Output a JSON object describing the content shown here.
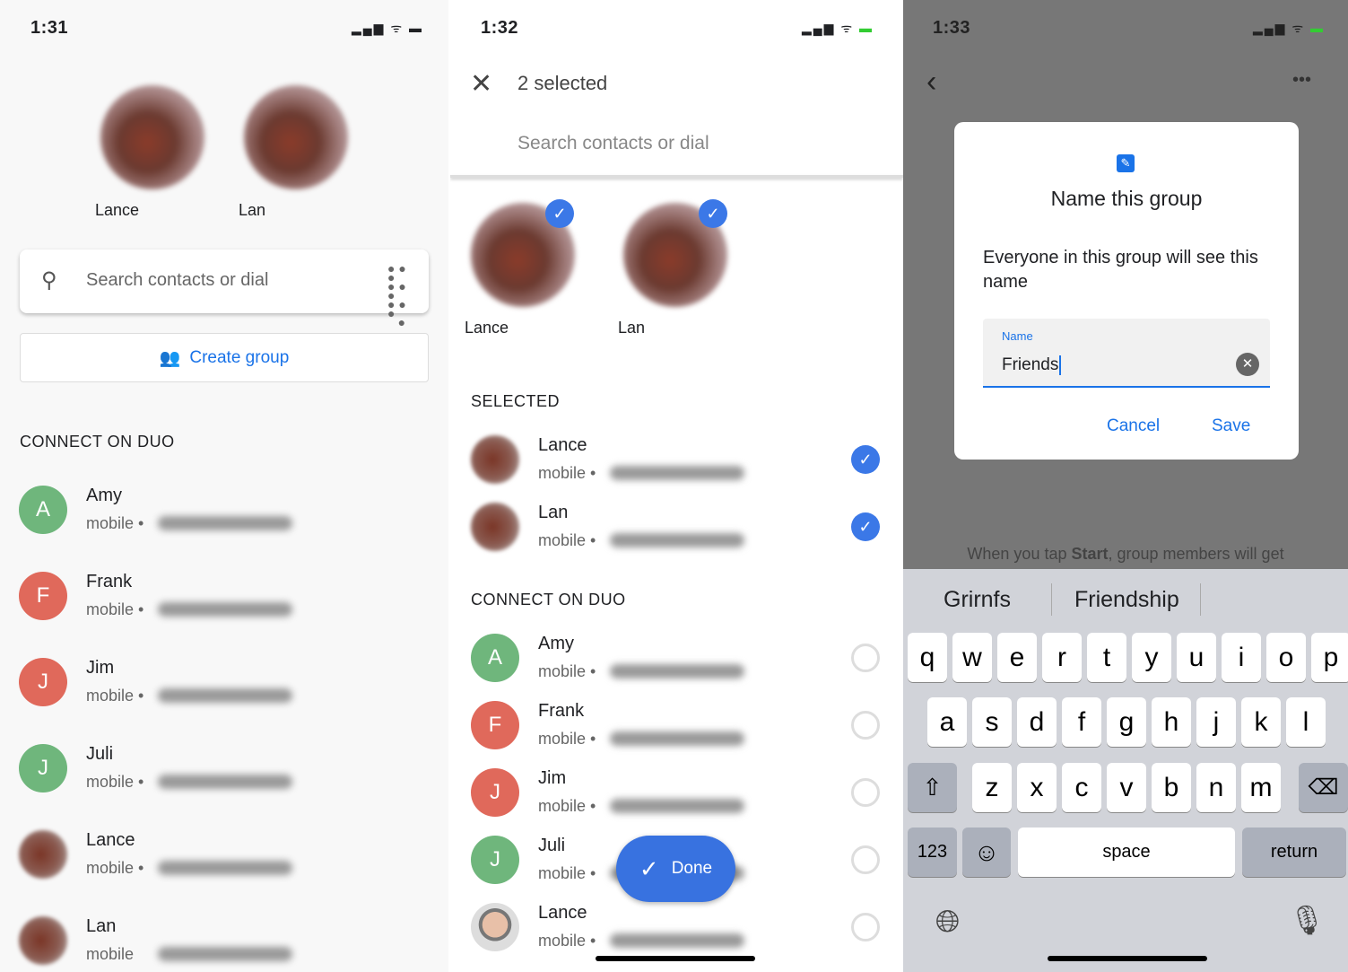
{
  "panel1": {
    "time": "1:31",
    "favorites": [
      "Lance",
      "Lan"
    ],
    "search_placeholder": "Search contacts or dial",
    "create_group": "Create group",
    "section": "CONNECT ON DUO",
    "contacts": [
      {
        "name": "Amy",
        "sub": "mobile •",
        "initial": "A",
        "color": "#6fb67c"
      },
      {
        "name": "Frank",
        "sub": "mobile •",
        "initial": "F",
        "color": "#e0695b"
      },
      {
        "name": "Jim",
        "sub": "mobile •",
        "initial": "J",
        "color": "#e0695b"
      },
      {
        "name": "Juli",
        "sub": "mobile •",
        "initial": "J",
        "color": "#6fb67c"
      },
      {
        "name": "Lance",
        "sub": "mobile •",
        "initial": "",
        "color": "blur"
      },
      {
        "name": "Lan",
        "sub": "mobile",
        "initial": "",
        "color": "blur"
      }
    ]
  },
  "panel2": {
    "time": "1:32",
    "title": "2 selected",
    "search_placeholder": "Search contacts or dial",
    "chips": [
      "Lance",
      "Lan"
    ],
    "selected_section": "SELECTED",
    "selected": [
      {
        "name": "Lance",
        "sub": "mobile •"
      },
      {
        "name": "Lan",
        "sub": "mobile •"
      }
    ],
    "connect_section": "CONNECT ON DUO",
    "contacts": [
      {
        "name": "Amy",
        "sub": "mobile •",
        "initial": "A",
        "color": "#6fb67c"
      },
      {
        "name": "Frank",
        "sub": "mobile •",
        "initial": "F",
        "color": "#e0695b"
      },
      {
        "name": "Jim",
        "sub": "mobile •",
        "initial": "J",
        "color": "#e0695b"
      },
      {
        "name": "Juli",
        "sub": "mobile •",
        "initial": "J",
        "color": "#6fb67c"
      },
      {
        "name": "Lance",
        "sub": "mobile •",
        "initial": "",
        "color": "photo"
      }
    ],
    "done": "Done",
    "accent": "#3872e0"
  },
  "panel3": {
    "time": "1:33",
    "dialog_title": "Name this group",
    "dialog_body": "Everyone in this group will see this name",
    "field_label": "Name",
    "field_value": "Friends",
    "cancel": "Cancel",
    "save": "Save",
    "background_text_pre": "When you tap ",
    "background_text_bold": "Start",
    "background_text_post": ", group members will get",
    "suggestions": [
      "Grirnfs",
      "Friendship"
    ],
    "keyboard": {
      "row1": [
        "q",
        "w",
        "e",
        "r",
        "t",
        "y",
        "u",
        "i",
        "o",
        "p"
      ],
      "row2": [
        "a",
        "s",
        "d",
        "f",
        "g",
        "h",
        "j",
        "k",
        "l"
      ],
      "row3": [
        "z",
        "x",
        "c",
        "v",
        "b",
        "n",
        "m"
      ],
      "numbers": "123",
      "space": "space",
      "return": "return"
    }
  }
}
